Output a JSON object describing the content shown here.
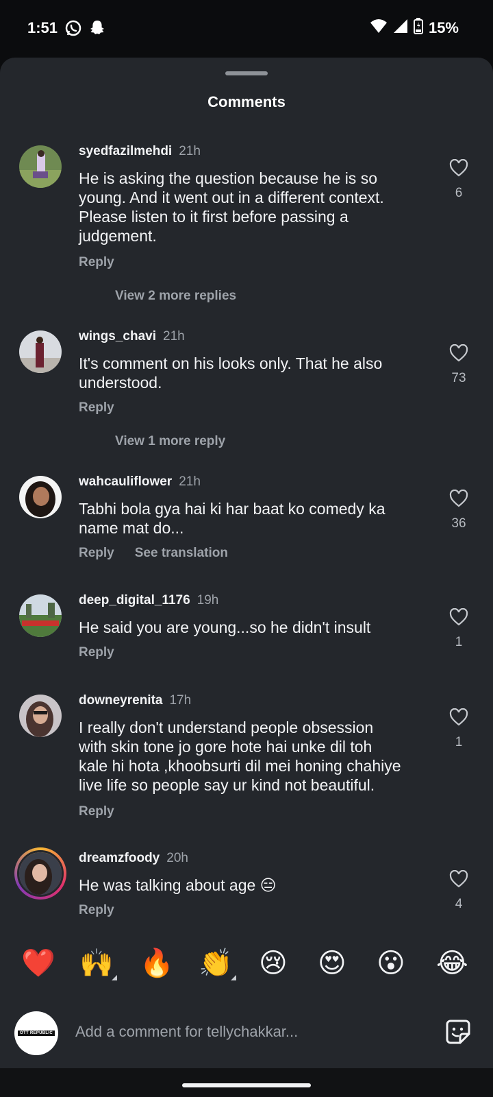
{
  "status_bar": {
    "time": "1:51",
    "battery_percent": "15%",
    "icons": [
      "whatsapp-icon",
      "snapchat-icon",
      "wifi-icon",
      "cellular-signal-icon",
      "battery-charging-icon"
    ]
  },
  "sheet": {
    "title": "Comments"
  },
  "comments": [
    {
      "username": "syedfazilmehdi",
      "time": "21h",
      "text_lines": [
        "He is asking the question because he is so",
        "young. And it went out in a different context.",
        "Please listen to it first before passing a",
        "judgement."
      ],
      "reply_label": "Reply",
      "likes": "6",
      "view_more": "View 2 more replies"
    },
    {
      "username": "wings_chavi",
      "time": "21h",
      "text_lines": [
        "It's comment on his looks only. That he also",
        "understood."
      ],
      "reply_label": "Reply",
      "likes": "73",
      "view_more": "View 1 more reply"
    },
    {
      "username": "wahcauliflower",
      "time": "21h",
      "text_lines": [
        "Tabhi bola gya hai ki har baat ko comedy ka",
        "name mat do..."
      ],
      "reply_label": "Reply",
      "translate_label": "See translation",
      "likes": "36"
    },
    {
      "username": "deep_digital_1176",
      "time": "19h",
      "text_lines": [
        "He said you are young...so he didn't insult"
      ],
      "reply_label": "Reply",
      "likes": "1"
    },
    {
      "username": "downeyrenita",
      "time": "17h",
      "text_lines": [
        "I really don't understand people obsession",
        "with skin tone jo gore hote hai unke dil toh",
        "kale hi hota ,khoobsurti dil mei honing chahiye",
        "live life so people say ur kind not beautiful."
      ],
      "reply_label": "Reply",
      "likes": "1"
    },
    {
      "username": "dreamzfoody",
      "time": "20h",
      "text_lines": [
        "He was talking about age 😑"
      ],
      "reply_label": "Reply",
      "likes": "4"
    }
  ],
  "emoji_bar": [
    "❤️",
    "🙌",
    "🔥",
    "👏",
    "😢",
    "😍",
    "😮",
    "😂"
  ],
  "composer": {
    "avatar_label": "OTT REPUBLIC",
    "placeholder": "Add a comment for tellychakkar..."
  },
  "colors": {
    "sheet_bg": "#24272c",
    "page_bg": "#0b0c0e",
    "text_primary": "#f2f3f5",
    "text_secondary": "#9ea3aa"
  }
}
